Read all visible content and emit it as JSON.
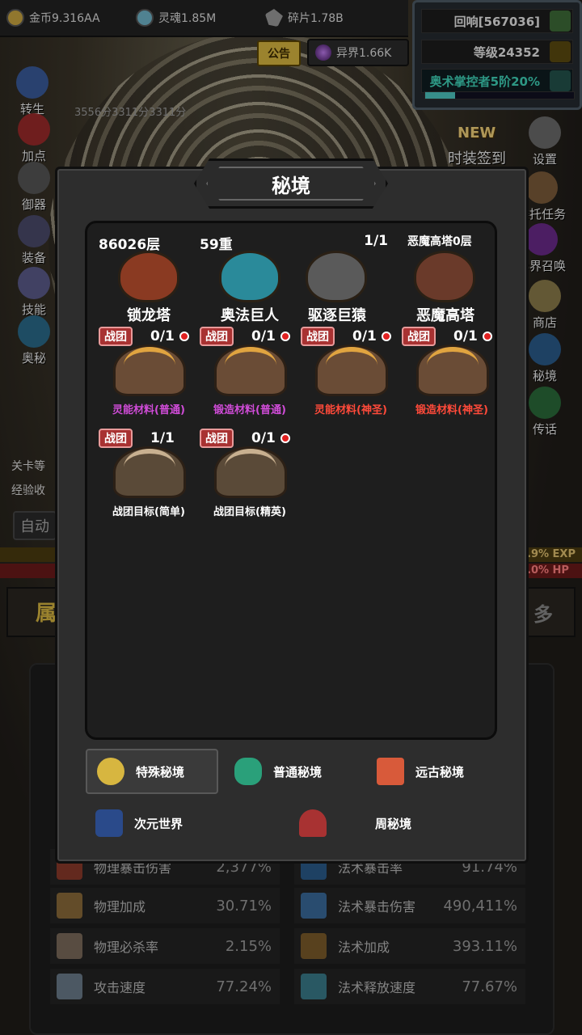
{
  "topbar": {
    "gold": "金币9.316AA",
    "soul": "灵魂1.85M",
    "shard": "碎片1.78B"
  },
  "notice_label": "公告",
  "other_world": "异界1.66K",
  "player": {
    "echo": "回响[567036]",
    "level": "等级24352",
    "rank": "奥术掌控者5阶20%",
    "rank_progress": 0.2
  },
  "left_menu": [
    "转生",
    "加点",
    "御器",
    "装备",
    "技能",
    "奥秘"
  ],
  "right_menu": [
    "设置",
    "委托任务",
    "异界召唤",
    "商店",
    "秘境",
    "传话"
  ],
  "event": {
    "new_label": "NEW",
    "fashion_checkin": "时装签到"
  },
  "misc": {
    "score_text": "3556分3311分3311分",
    "stage_label": "关卡等",
    "exp_label": "经验收",
    "auto_label": "自动",
    "exp_pct": ".9% EXP",
    "hp_pct": ".0% HP",
    "attr_tab": "属",
    "more_tab": "多"
  },
  "stats": [
    {
      "label": "物理暴击伤害",
      "value": "2,377%"
    },
    {
      "label": "法术暴击率",
      "value": "91.74%"
    },
    {
      "label": "物理加成",
      "value": "30.71%"
    },
    {
      "label": "法术暴击伤害",
      "value": "490,411%"
    },
    {
      "label": "物理必杀率",
      "value": "2.15%"
    },
    {
      "label": "法术加成",
      "value": "393.11%"
    },
    {
      "label": "攻击速度",
      "value": "77.24%"
    },
    {
      "label": "法术释放速度",
      "value": "77.67%"
    }
  ],
  "modal": {
    "title": "秘境",
    "dungeons": [
      {
        "left": "86026层",
        "right": "",
        "name": "锁龙塔"
      },
      {
        "left": "59重",
        "right": "",
        "name": "奥法巨人"
      },
      {
        "left": "",
        "right": "1/1",
        "name": "驱逐巨猿"
      },
      {
        "left": "恶魔高塔0层",
        "right": "",
        "name": "恶魔高塔"
      }
    ],
    "materials": [
      {
        "tag": "战团",
        "count": "0/1",
        "label": "灵能材料(普通)",
        "color": "#d04cd8",
        "alert": true
      },
      {
        "tag": "战团",
        "count": "0/1",
        "label": "锻造材料(普通)",
        "color": "#d04cd8",
        "alert": true
      },
      {
        "tag": "战团",
        "count": "0/1",
        "label": "灵能材料(神圣)",
        "color": "#ff4a3a",
        "alert": true
      },
      {
        "tag": "战团",
        "count": "0/1",
        "label": "锻造材料(神圣)",
        "color": "#ff4a3a",
        "alert": true
      },
      {
        "tag": "战团",
        "count": "1/1",
        "label": "战团目标(简单)",
        "color": "#ffffff",
        "alert": false
      },
      {
        "tag": "战团",
        "count": "0/1",
        "label": "战团目标(精英)",
        "color": "#ffffff",
        "alert": true
      }
    ],
    "tabs": [
      {
        "label": "特殊秘境",
        "active": true
      },
      {
        "label": "普通秘境",
        "active": false
      },
      {
        "label": "远古秘境",
        "active": false
      },
      {
        "label": "次元世界",
        "active": false
      },
      {
        "label": "周秘境",
        "active": false
      }
    ]
  }
}
